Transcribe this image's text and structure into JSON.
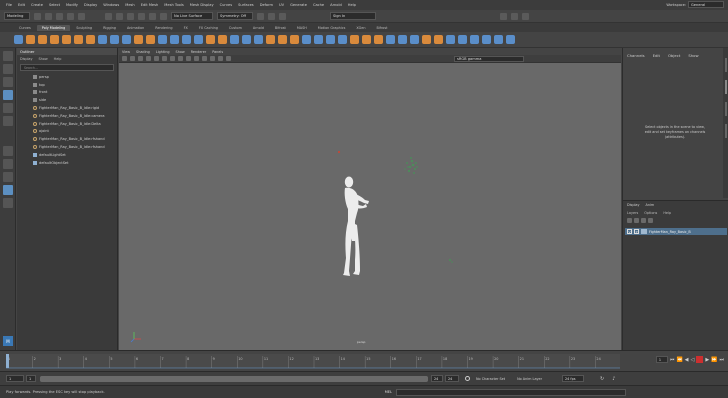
{
  "menubar": [
    "File",
    "Edit",
    "Create",
    "Select",
    "Modify",
    "Display",
    "Windows",
    "Mesh",
    "Edit Mesh",
    "Mesh Tools",
    "Mesh Display",
    "Curves",
    "Surfaces",
    "Deform",
    "UV",
    "Generate",
    "Cache",
    "Arnold",
    "Help"
  ],
  "workspace": {
    "label": "Workspace:",
    "value": "General"
  },
  "statusline": {
    "mode": "Modeling",
    "live_surface": "No Live Surface",
    "symmetry": "Symmetry: Off",
    "sign_in": "Sign In"
  },
  "shelf_tabs": [
    "Curves",
    "Poly Modeling",
    "Sculpting",
    "Rigging",
    "Animation",
    "Rendering",
    "FX",
    "FX Caching",
    "Custom",
    "Arnold",
    "Bifrost",
    "MASH",
    "Motion Graphics",
    "XGen",
    "Bifrost"
  ],
  "shelf_active": "Poly Modeling",
  "outliner": {
    "title": "Outliner",
    "menu": [
      "Display",
      "Show",
      "Help"
    ],
    "search_placeholder": "Search...",
    "items": [
      {
        "label": "persp",
        "icon": "camera-icon"
      },
      {
        "label": "top",
        "icon": "camera-icon"
      },
      {
        "label": "front",
        "icon": "camera-icon"
      },
      {
        "label": "side",
        "icon": "camera-icon"
      },
      {
        "label": "FighterMan_Ray_Basic_B_Idle:rigid",
        "icon": "joint-icon"
      },
      {
        "label": "FighterMan_Ray_Basic_B_Idle:camera",
        "icon": "joint-icon"
      },
      {
        "label": "FighterMan_Ray_Basic_B_Idle:Delta",
        "icon": "joint-icon"
      },
      {
        "label": "ojoint",
        "icon": "joint-icon"
      },
      {
        "label": "FighterMan_Ray_Basic_B_Idle:rfshand",
        "icon": "joint-icon"
      },
      {
        "label": "FighterMan_Ray_Basic_B_Idle:rfshand",
        "icon": "joint-icon"
      },
      {
        "label": "defaultLightSet",
        "icon": "set-icon"
      },
      {
        "label": "defaultObjectSet",
        "icon": "set-icon"
      }
    ]
  },
  "viewport": {
    "menu": [
      "View",
      "Shading",
      "Lighting",
      "Show",
      "Renderer",
      "Panels"
    ],
    "camera_label": "persp",
    "colorspace": "sRGB gamma"
  },
  "channelbox": {
    "tabs": [
      "Channels",
      "Edit",
      "Object",
      "Show"
    ],
    "message_lines": [
      "Select objects in the scene to view,",
      "edit and set keyframes on channels",
      "(attributes)."
    ]
  },
  "layers": {
    "tabs": [
      "Display",
      "Anim"
    ],
    "menu": [
      "Layers",
      "Options",
      "Help"
    ],
    "row": {
      "v": "V",
      "p": "P",
      "name": "FighterMan_Ray_Basic_B"
    }
  },
  "timeline": {
    "ticks": [
      "1",
      "2",
      "3",
      "4",
      "5",
      "6",
      "7",
      "8",
      "9",
      "10",
      "11",
      "12",
      "13",
      "14",
      "15",
      "16",
      "17",
      "18",
      "19",
      "20",
      "21",
      "22",
      "23",
      "24"
    ],
    "current_frame": "1"
  },
  "range": {
    "start": "1",
    "range_start": "1",
    "range_end": "24",
    "end": "24",
    "fps": "24 fps",
    "char_set": "No Character Set",
    "anim_layer": "No Anim Layer"
  },
  "helpline": {
    "script_label": "MEL",
    "message": "Play forwards. Pressing the ESC key will stop playback."
  },
  "colors": {
    "accent": "#5c8fc1",
    "viewport": "#696969",
    "character": "#ececec",
    "play_red": "#cc2f2f"
  }
}
